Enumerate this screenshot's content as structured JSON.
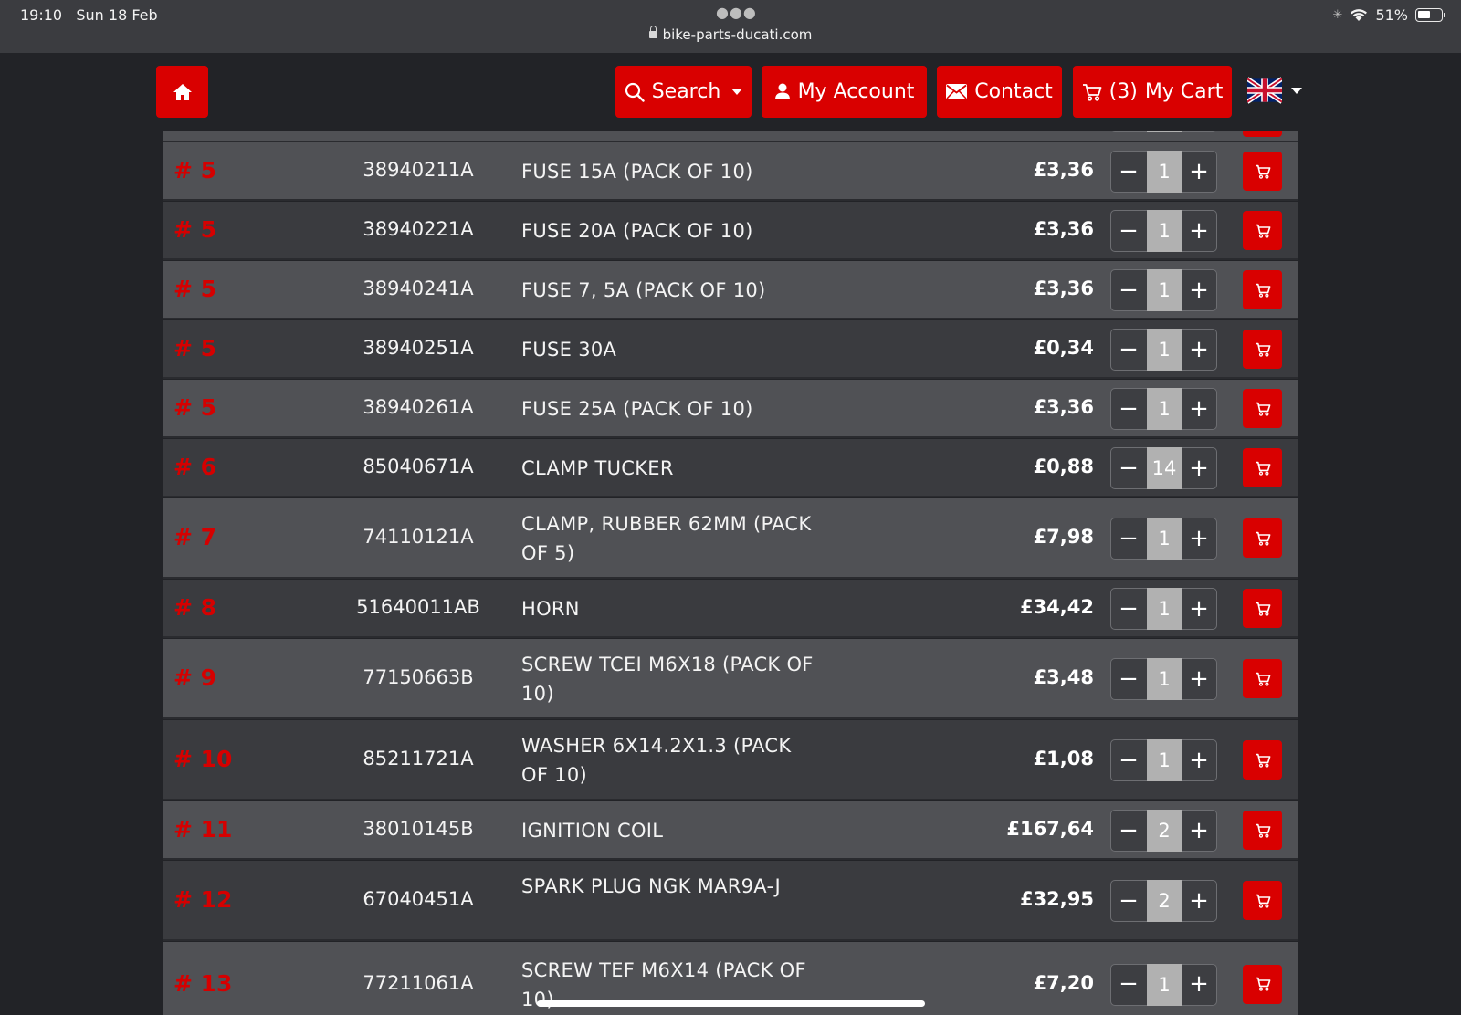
{
  "status_bar": {
    "time": "19:10",
    "date": "Sun 18 Feb",
    "url": "bike-parts-ducati.com",
    "battery": "51%",
    "battery_level": 0.51
  },
  "nav": {
    "search_label": "Search",
    "account_label": "My Account",
    "contact_label": "Contact",
    "cart_count": "(3)",
    "cart_label": "My Cart",
    "flag_icon": "uk-flag-icon"
  },
  "colors": {
    "accent": "#d90000",
    "ref_text": "#d50000",
    "row_light": "#505155",
    "row_dark": "#3a3b3f"
  },
  "rows": [
    {
      "ref": "# 5",
      "part": "38940211A",
      "desc": "FUSE 15A (PACK OF 10)",
      "price": "£3,36",
      "qty": "1"
    },
    {
      "ref": "# 5",
      "part": "38940221A",
      "desc": "FUSE 20A (PACK OF 10)",
      "price": "£3,36",
      "qty": "1"
    },
    {
      "ref": "# 5",
      "part": "38940241A",
      "desc": "FUSE 7, 5A (PACK OF 10)",
      "price": "£3,36",
      "qty": "1"
    },
    {
      "ref": "# 5",
      "part": "38940251A",
      "desc": "FUSE 30A",
      "price": "£0,34",
      "qty": "1"
    },
    {
      "ref": "# 5",
      "part": "38940261A",
      "desc": "FUSE 25A (PACK OF 10)",
      "price": "£3,36",
      "qty": "1"
    },
    {
      "ref": "# 6",
      "part": "85040671A",
      "desc": "CLAMP TUCKER",
      "price": "£0,88",
      "qty": "14"
    },
    {
      "ref": "# 7",
      "part": "74110121A",
      "desc": "CLAMP, RUBBER 62MM (PACK OF 5)",
      "price": "£7,98",
      "qty": "1"
    },
    {
      "ref": "# 8",
      "part": "51640011AB",
      "desc": "HORN",
      "price": "£34,42",
      "qty": "1"
    },
    {
      "ref": "# 9",
      "part": "77150663B",
      "desc": "SCREW TCEI M6X18 (PACK OF 10)",
      "price": "£3,48",
      "qty": "1"
    },
    {
      "ref": "# 10",
      "part": "85211721A",
      "desc": "WASHER 6X14.2X1.3 (PACK OF 10)",
      "price": "£1,08",
      "qty": "1"
    },
    {
      "ref": "# 11",
      "part": "38010145B",
      "desc": "IGNITION COIL",
      "price": "£167,64",
      "qty": "2"
    },
    {
      "ref": "# 12",
      "part": "67040451A",
      "desc": "SPARK PLUG NGK MAR9A-J",
      "price": "£32,95",
      "qty": "2"
    },
    {
      "ref": "# 13",
      "part": "77211061A",
      "desc": "SCREW TEF M6X14 (PACK OF 10)",
      "price": "£7,20",
      "qty": "1"
    }
  ],
  "qty_controls": {
    "minus": "−",
    "plus": "+"
  }
}
